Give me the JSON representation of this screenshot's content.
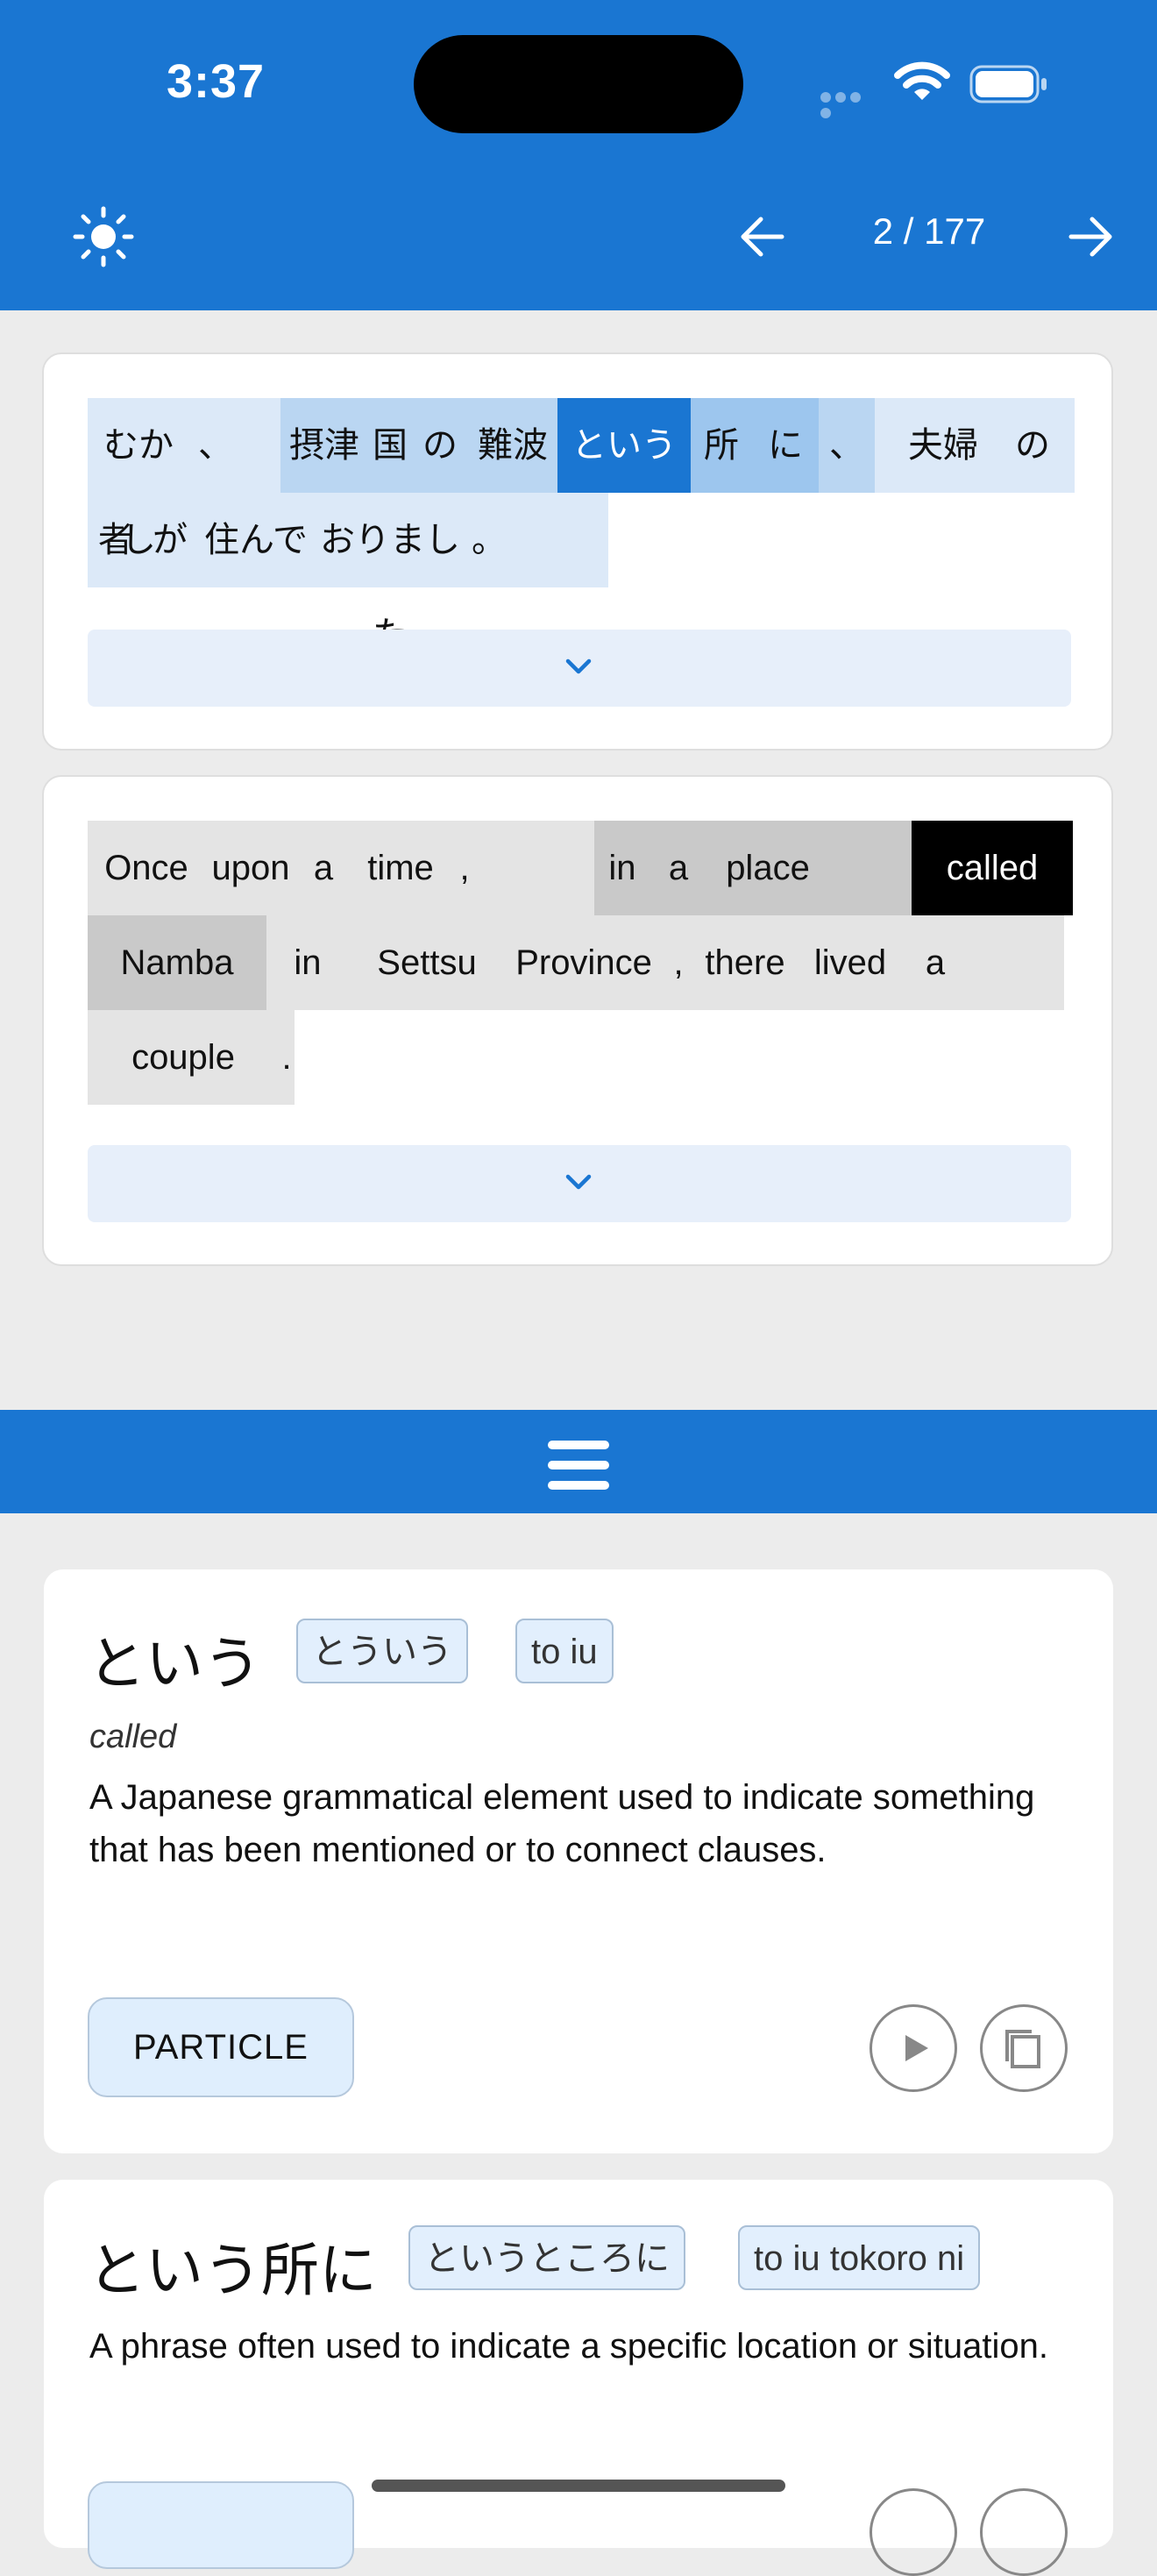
{
  "status_bar": {
    "time": "3:37"
  },
  "header": {
    "page_indicator": "2 / 177"
  },
  "japanese": {
    "tokens": [
      {
        "text": "むかし",
        "hl": "light"
      },
      {
        "text": "、",
        "hl": "light"
      },
      {
        "text": "摂津",
        "hl": "mid"
      },
      {
        "text": "国",
        "hl": "mid"
      },
      {
        "text": "の",
        "hl": "mid"
      },
      {
        "text": "難波",
        "hl": "mid"
      },
      {
        "text": "という",
        "hl": "active"
      },
      {
        "text": "所",
        "hl": "strong"
      },
      {
        "text": "に",
        "hl": "strong"
      },
      {
        "text": "、",
        "hl": "mid"
      },
      {
        "text": "夫婦",
        "hl": "light"
      },
      {
        "text": "の",
        "hl": "light"
      },
      {
        "text": "者",
        "hl": "light"
      },
      {
        "text": "が",
        "hl": "light"
      },
      {
        "text": "住んで",
        "hl": "light"
      },
      {
        "text": "おりました",
        "hl": "light"
      },
      {
        "text": "。",
        "hl": "light"
      }
    ]
  },
  "english": {
    "tokens": [
      {
        "text": "Once",
        "hl": "light"
      },
      {
        "text": "upon",
        "hl": "light"
      },
      {
        "text": "a",
        "hl": "light"
      },
      {
        "text": "time",
        "hl": "light"
      },
      {
        "text": ",",
        "hl": "light"
      },
      {
        "text": "in",
        "hl": "mid"
      },
      {
        "text": "a",
        "hl": "mid"
      },
      {
        "text": "place",
        "hl": "mid"
      },
      {
        "text": "called",
        "hl": "active"
      },
      {
        "text": "Namba",
        "hl": "mid"
      },
      {
        "text": "in",
        "hl": "light"
      },
      {
        "text": "Settsu",
        "hl": "light"
      },
      {
        "text": "Province",
        "hl": "light"
      },
      {
        "text": ",",
        "hl": "light"
      },
      {
        "text": "there",
        "hl": "light"
      },
      {
        "text": "lived",
        "hl": "light"
      },
      {
        "text": "a",
        "hl": "light"
      },
      {
        "text": "couple",
        "hl": "light"
      },
      {
        "text": ".",
        "hl": "light"
      }
    ]
  },
  "definitions": [
    {
      "word": "という",
      "kana": "とういう",
      "romaji": "to iu",
      "gloss": "called",
      "description": "A Japanese grammatical element used to indicate something that has been mentioned or to connect clauses.",
      "pos": "PARTICLE"
    },
    {
      "word": "という所に",
      "kana": "というところに",
      "romaji": "to iu tokoro ni",
      "description": "A phrase often used to indicate a specific location or situation."
    }
  ],
  "icons": [
    "sun-icon",
    "arrow-left-icon",
    "arrow-right-icon",
    "chevron-down-icon",
    "menu-icon",
    "play-icon",
    "copy-icon",
    "wifi-icon",
    "battery-icon"
  ],
  "colors": {
    "primary": "#1a76d2",
    "active_highlight": "#1a76d2",
    "active_en": "#000000"
  }
}
